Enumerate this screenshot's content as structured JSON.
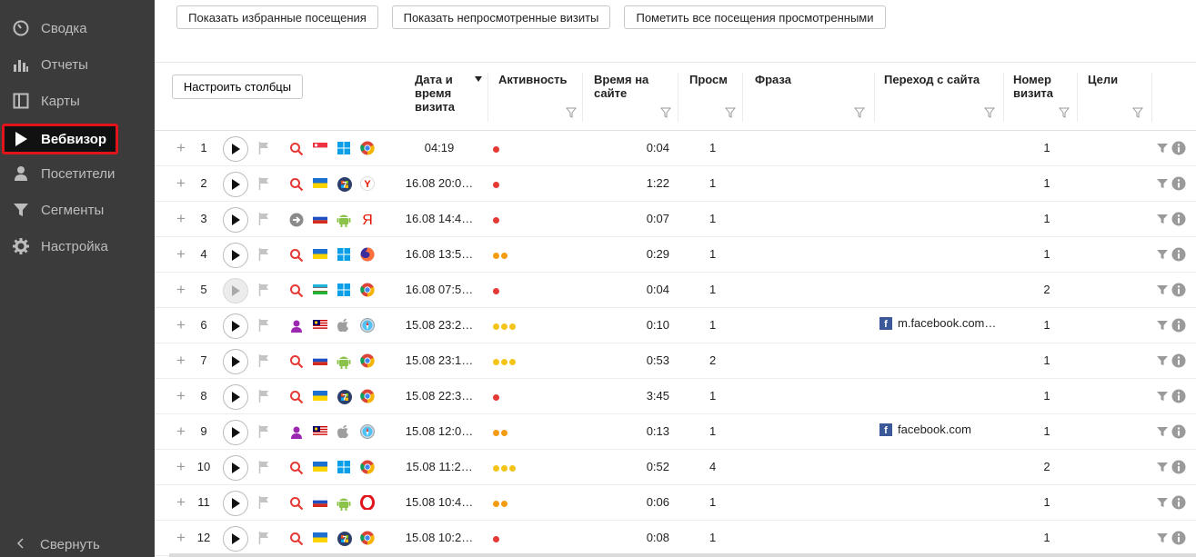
{
  "sidebar": {
    "items": [
      {
        "label": "Сводка",
        "icon": "gauge-icon"
      },
      {
        "label": "Отчеты",
        "icon": "bar-chart-icon"
      },
      {
        "label": "Карты",
        "icon": "map-icon"
      },
      {
        "label": "Вебвизор",
        "icon": "play-icon"
      },
      {
        "label": "Посетители",
        "icon": "person-icon"
      },
      {
        "label": "Сегменты",
        "icon": "funnel-icon"
      },
      {
        "label": "Настройка",
        "icon": "gear-icon"
      }
    ],
    "active_index": 3,
    "collapse_label": "Свернуть"
  },
  "toolbar": {
    "favorites_label": "Показать избранные посещения",
    "unviewed_label": "Показать непросмотренные визиты",
    "mark_viewed_label": "Пометить все посещения просмотренными"
  },
  "table": {
    "configure_columns_label": "Настроить столбцы",
    "columns": {
      "datetime": [
        "Дата и",
        "время",
        "визита"
      ],
      "activity": "Активность",
      "time_on_site": [
        "Время на",
        "сайте"
      ],
      "pageviews": "Просм",
      "phrase": "Фраза",
      "referrer": "Переход с сайта",
      "visit_number": [
        "Номер",
        "визита"
      ],
      "goals": "Цели"
    },
    "rows": [
      {
        "num": "1",
        "source": "search",
        "country": "sg",
        "os": "windows",
        "browser": "chrome",
        "datetime": "04:19",
        "activity": 1,
        "time": "0:04",
        "views": "1",
        "referrer": "",
        "visit": "1",
        "play_dim": false
      },
      {
        "num": "2",
        "source": "search",
        "country": "ua",
        "os": "win7",
        "browser": "yandex",
        "datetime": "16.08 20:0…",
        "activity": 1,
        "time": "1:22",
        "views": "1",
        "referrer": "",
        "visit": "1",
        "play_dim": false
      },
      {
        "num": "3",
        "source": "direct",
        "country": "ru",
        "os": "android",
        "browser": "yandex",
        "datetime": "16.08 14:4…",
        "activity": 1,
        "time": "0:07",
        "views": "1",
        "referrer": "",
        "visit": "1",
        "play_dim": false
      },
      {
        "num": "4",
        "source": "search",
        "country": "ua",
        "os": "windows",
        "browser": "firefox",
        "datetime": "16.08 13:5…",
        "activity": 2,
        "time": "0:29",
        "views": "1",
        "referrer": "",
        "visit": "1",
        "play_dim": false
      },
      {
        "num": "5",
        "source": "search",
        "country": "uz",
        "os": "windows",
        "browser": "chrome",
        "datetime": "16.08 07:5…",
        "activity": 1,
        "time": "0:04",
        "views": "1",
        "referrer": "",
        "visit": "2",
        "play_dim": true
      },
      {
        "num": "6",
        "source": "social",
        "country": "my",
        "os": "apple",
        "browser": "safari",
        "datetime": "15.08 23:2…",
        "activity": 3,
        "time": "0:10",
        "views": "1",
        "referrer": "m.facebook.com…",
        "visit": "1",
        "play_dim": false
      },
      {
        "num": "7",
        "source": "search",
        "country": "ru",
        "os": "android",
        "browser": "chrome",
        "datetime": "15.08 23:1…",
        "activity": 3,
        "time": "0:53",
        "views": "2",
        "referrer": "",
        "visit": "1",
        "play_dim": false
      },
      {
        "num": "8",
        "source": "search",
        "country": "ua",
        "os": "win7",
        "browser": "chrome",
        "datetime": "15.08 22:3…",
        "activity": 1,
        "time": "3:45",
        "views": "1",
        "referrer": "",
        "visit": "1",
        "play_dim": false
      },
      {
        "num": "9",
        "source": "social",
        "country": "my",
        "os": "apple",
        "browser": "safari",
        "datetime": "15.08 12:0…",
        "activity": 2,
        "time": "0:13",
        "views": "1",
        "referrer": "facebook.com",
        "visit": "1",
        "play_dim": false
      },
      {
        "num": "10",
        "source": "search",
        "country": "ua",
        "os": "windows",
        "browser": "chrome",
        "datetime": "15.08 11:2…",
        "activity": 3,
        "time": "0:52",
        "views": "4",
        "referrer": "",
        "visit": "2",
        "play_dim": false
      },
      {
        "num": "11",
        "source": "search",
        "country": "ru",
        "os": "android",
        "browser": "opera",
        "datetime": "15.08 10:4…",
        "activity": 2,
        "time": "0:06",
        "views": "1",
        "referrer": "",
        "visit": "1",
        "play_dim": false
      },
      {
        "num": "12",
        "source": "search",
        "country": "ua",
        "os": "win7",
        "browser": "chrome",
        "datetime": "15.08 10:2…",
        "activity": 1,
        "time": "0:08",
        "views": "1",
        "referrer": "",
        "visit": "1",
        "play_dim": false
      }
    ]
  },
  "colors": {
    "sidebar_bg": "#3b3b3b",
    "active_outline": "#e0141a",
    "activity_low": "#e53935",
    "activity_mid": "#f39c12",
    "activity_high": "#f4c518"
  }
}
